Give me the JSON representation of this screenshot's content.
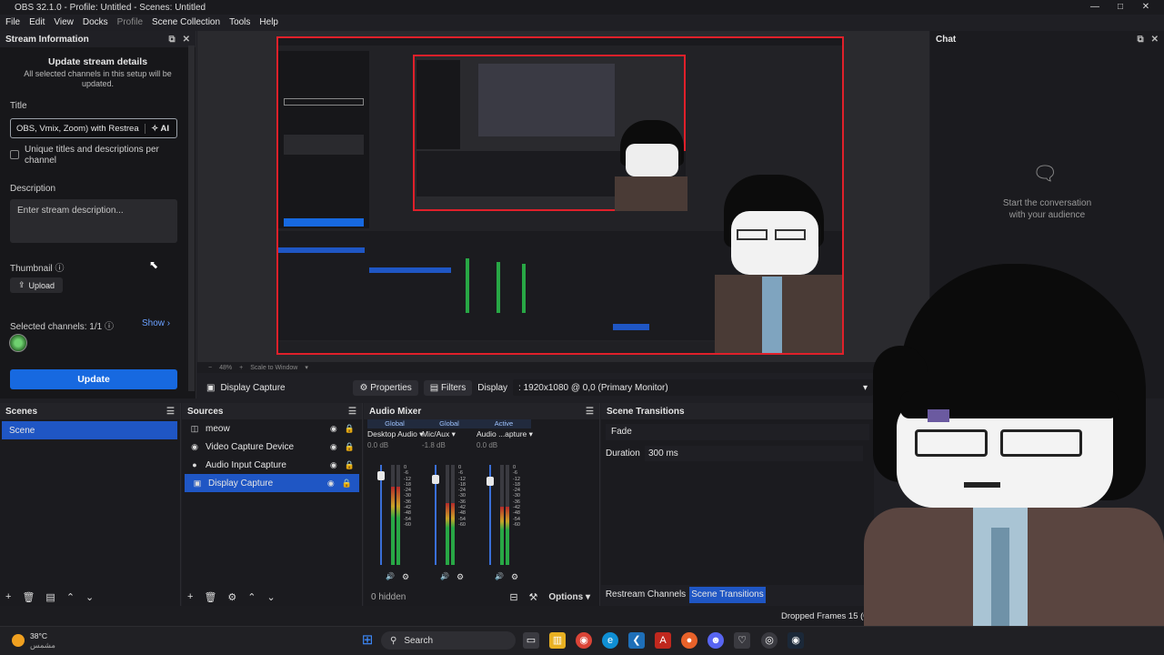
{
  "window": {
    "title": "OBS 32.1.0 - Profile: Untitled - Scenes: Untitled"
  },
  "menu": [
    "File",
    "Edit",
    "View",
    "Docks",
    "Profile",
    "Scene Collection",
    "Tools",
    "Help"
  ],
  "stream_info": {
    "dock_title": "Stream Information",
    "heading": "Update stream details",
    "subheading": "All selected channels in this setup will be updated.",
    "title_label": "Title",
    "title_value": "OBS, Vmix, Zoom) with Restrea",
    "ai_label": "AI",
    "unique_label": "Unique titles and descriptions per channel",
    "description_label": "Description",
    "description_placeholder": "Enter stream description...",
    "thumbnail_label": "Thumbnail",
    "upload_label": "Upload",
    "selected_channels": "Selected channels: 1/1",
    "show_label": "Show",
    "update_label": "Update"
  },
  "preview": {
    "zoom": "48%",
    "scale_mode": "Scale to Window"
  },
  "chat": {
    "dock_title": "Chat",
    "empty_line1": "Start the conversation",
    "empty_line2": "with your audience"
  },
  "source_toolbar": {
    "source_name": "Display Capture",
    "properties_label": "Properties",
    "filters_label": "Filters",
    "display_label": "Display",
    "display_value": ": 1920x1080 @ 0,0 (Primary Monitor)"
  },
  "scenes": {
    "title": "Scenes",
    "items": [
      "Scene"
    ]
  },
  "sources": {
    "title": "Sources",
    "items": [
      {
        "name": "meow",
        "icon": "layers-icon"
      },
      {
        "name": "Video Capture Device",
        "icon": "camera-icon"
      },
      {
        "name": "Audio Input Capture",
        "icon": "mic-icon"
      },
      {
        "name": "Display Capture",
        "icon": "monitor-icon"
      }
    ]
  },
  "audio_mixer": {
    "title": "Audio Mixer",
    "channels": [
      {
        "tag": "Global",
        "name": "Desktop Audio",
        "db": "0.0 dB",
        "level": 0.78
      },
      {
        "tag": "Global",
        "name": "Mic/Aux",
        "db": "-1.8 dB",
        "level": 0.62
      },
      {
        "tag": "Active",
        "name": "Audio ...apture",
        "db": "0.0 dB",
        "level": 0.58
      }
    ],
    "ticks": [
      "0",
      "-6",
      "-12",
      "-18",
      "-24",
      "-30",
      "-36",
      "-42",
      "-48",
      "-54",
      "-60"
    ],
    "hidden_label": "0 hidden",
    "options_label": "Options"
  },
  "scene_transitions": {
    "title": "Scene Transitions",
    "transition": "Fade",
    "duration_label": "Duration",
    "duration_value": "300 ms"
  },
  "bottom_tabs": [
    "Restream Channels",
    "Scene Transitions"
  ],
  "status": {
    "dropped_frames": "Dropped Frames 15 (0.0%)"
  },
  "taskbar": {
    "weather_temp": "38°C",
    "weather_desc": "مشمس",
    "search_label": "Search"
  },
  "colors": {
    "accent": "#1769e0",
    "selection": "#1f56c4",
    "capture_border": "#e0202a"
  }
}
